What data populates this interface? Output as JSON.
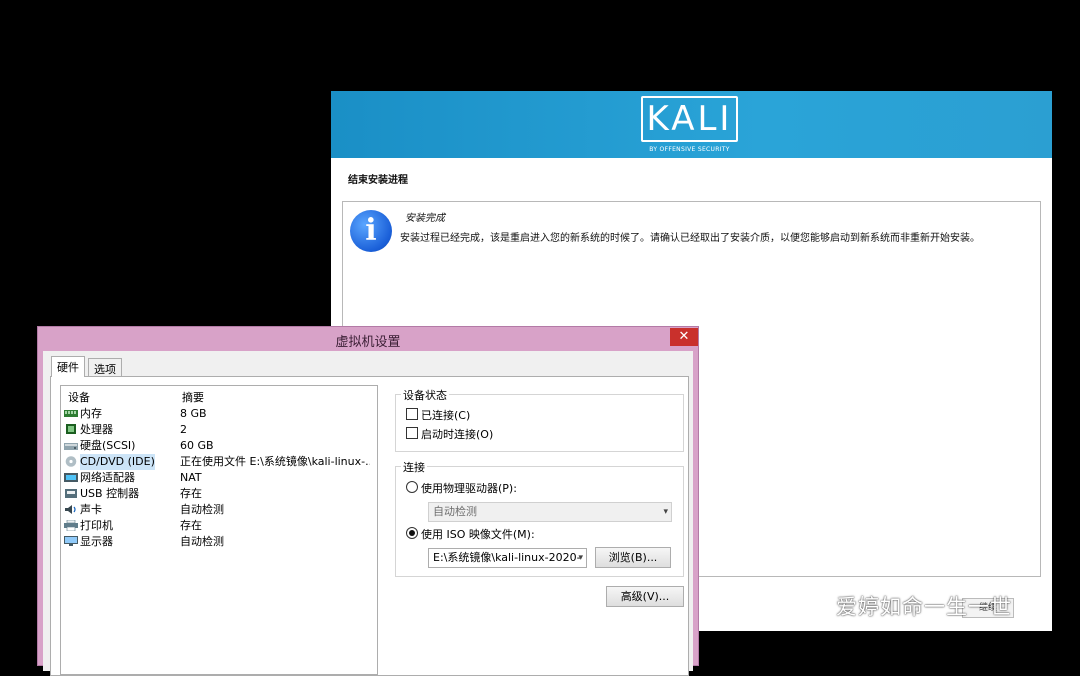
{
  "installer": {
    "logo_text": "KALI",
    "logo_subtitle": "BY OFFENSIVE SECURITY",
    "step_title": "结束安装进程",
    "info_heading": "安装完成",
    "info_message": "安装过程已经完成，该是重启进入您的新系统的时候了。请确认已经取出了安装介质，以便您能够启动到新系统而非重新开始安装。",
    "continue_label": "继续",
    "brand_color": "#2aa4d8"
  },
  "dialog": {
    "title": "虚拟机设置",
    "close_glyph": "✕",
    "tabs": [
      {
        "label": "硬件",
        "active": true
      },
      {
        "label": "选项",
        "active": false
      }
    ],
    "device_list": {
      "col_device": "设备",
      "col_summary": "摘要",
      "rows": [
        {
          "name": "内存",
          "summary": "8 GB",
          "icon": "memory-icon"
        },
        {
          "name": "处理器",
          "summary": "2",
          "icon": "processor-icon"
        },
        {
          "name": "硬盘(SCSI)",
          "summary": "60 GB",
          "icon": "hard-disk-icon"
        },
        {
          "name": "CD/DVD (IDE)",
          "summary": "正在使用文件 E:\\系统镜像\\kali-linux-...",
          "icon": "cd-dvd-icon",
          "selected": true
        },
        {
          "name": "网络适配器",
          "summary": "NAT",
          "icon": "network-adapter-icon"
        },
        {
          "name": "USB 控制器",
          "summary": "存在",
          "icon": "usb-icon"
        },
        {
          "name": "声卡",
          "summary": "自动检测",
          "icon": "sound-card-icon"
        },
        {
          "name": "打印机",
          "summary": "存在",
          "icon": "printer-icon"
        },
        {
          "name": "显示器",
          "summary": "自动检测",
          "icon": "display-icon"
        }
      ]
    },
    "device_status": {
      "group_label": "设备状态",
      "connected_label": "已连接(C)",
      "connected": false,
      "connect_at_power_on_label": "启动时连接(O)",
      "connect_at_power_on": false
    },
    "connection": {
      "group_label": "连接",
      "physical_drive_label": "使用物理驱动器(P):",
      "physical_drive_selected": false,
      "physical_drive_value": "自动检测",
      "iso_label": "使用 ISO 映像文件(M):",
      "iso_selected": true,
      "iso_path": "E:\\系统镜像\\kali-linux-2020-",
      "browse_label": "浏览(B)..."
    },
    "advanced_label": "高级(V)...",
    "frame_color": "#d8a2c8"
  },
  "watermark": {
    "text": "爱婷如命一生一世"
  }
}
